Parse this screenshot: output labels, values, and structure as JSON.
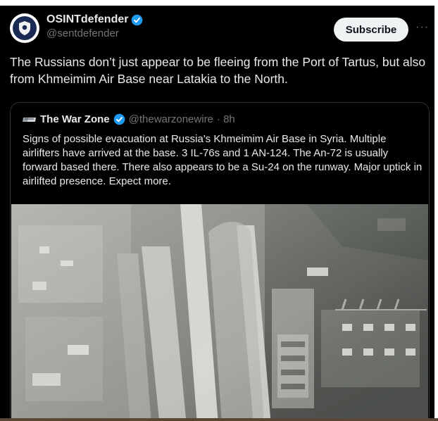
{
  "post": {
    "display_name": "OSINTdefender",
    "handle": "@sentdefender",
    "subscribe_label": "Subscribe",
    "more_label": "···",
    "text": "The Russians don’t just appear to be fleeing from the Port of Tartus, but also from Khmeimim Air Base near Latakia to the North."
  },
  "quote": {
    "display_name": "The War Zone",
    "handle": "@thewarzonewire",
    "time": "· 8h",
    "text": "Signs of possible evacuation at Russia's Khmeimim Air Base in Syria. Multiple airlifters have arrived at the base. 3 IL-76s and 1 AN-124. The An-72 is usually forward based there. There also appears to be a Su-24 on the runway. Major uptick in airlifted presence. Expect more.",
    "media": "satellite-image-airbase"
  },
  "colors": {
    "background": "#000000",
    "text": "#e7e9ea",
    "muted": "#71767b",
    "verified": "#1d9bf0",
    "subscribe_bg": "#eff3f4"
  }
}
